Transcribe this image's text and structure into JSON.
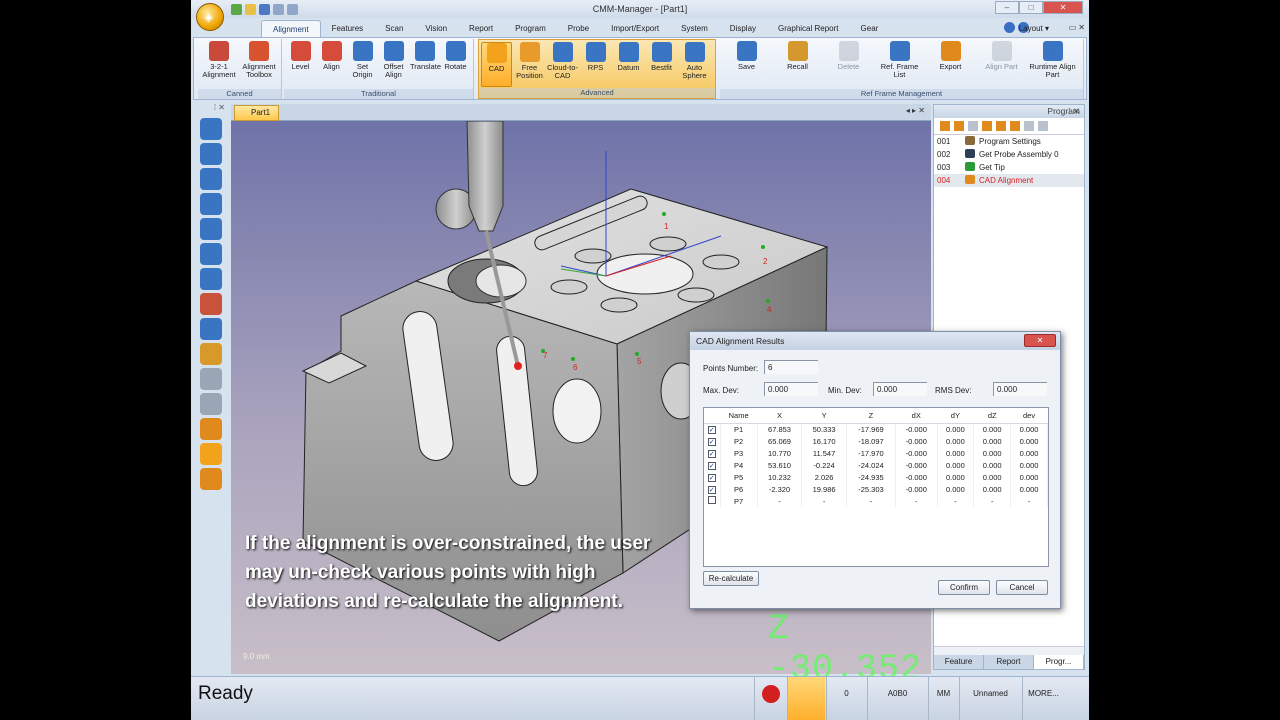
{
  "window": {
    "title": "CMM-Manager - [Part1]",
    "layout_label": "Layout"
  },
  "tabs": [
    "Alignment",
    "Features",
    "Scan",
    "Vision",
    "Report",
    "Program",
    "Probe",
    "Import/Export",
    "System",
    "Display",
    "Graphical Report",
    "Gear"
  ],
  "ribbon": {
    "groups": [
      {
        "name": "Canned",
        "buttons": [
          {
            "label": "3-2-1 Alignment",
            "icon": "three-two-one-icon"
          },
          {
            "label": "Alignment Toolbox",
            "icon": "toolbox-icon"
          }
        ]
      },
      {
        "name": "Traditional",
        "buttons": [
          {
            "label": "Level",
            "icon": "level-icon"
          },
          {
            "label": "Align",
            "icon": "align-icon"
          },
          {
            "label": "Set Origin",
            "icon": "origin-icon"
          },
          {
            "label": "Offset Align",
            "icon": "offset-icon"
          },
          {
            "label": "Translate",
            "icon": "translate-icon"
          },
          {
            "label": "Rotate",
            "icon": "rotate-icon"
          }
        ]
      },
      {
        "name": "Advanced",
        "buttons": [
          {
            "label": "CAD",
            "icon": "cad-icon"
          },
          {
            "label": "Free Position",
            "icon": "free-position-icon"
          },
          {
            "label": "Cloud-to-CAD",
            "icon": "cloud-icon"
          },
          {
            "label": "RPS",
            "icon": "rps-icon"
          },
          {
            "label": "Datum",
            "icon": "datum-icon"
          },
          {
            "label": "Bestfit",
            "icon": "bestfit-icon"
          },
          {
            "label": "Auto Sphere",
            "icon": "sphere-icon"
          }
        ]
      },
      {
        "name": "Ref Frame Management",
        "buttons": [
          {
            "label": "Save",
            "icon": "save-icon"
          },
          {
            "label": "Recall",
            "icon": "recall-icon"
          },
          {
            "label": "Delete",
            "icon": "delete-icon"
          },
          {
            "label": "Ref. Frame List",
            "icon": "list-icon"
          },
          {
            "label": "Export",
            "icon": "export-icon"
          },
          {
            "label": "Align Part",
            "icon": "align-part-icon"
          },
          {
            "label": "Runtime Align Part",
            "icon": "runtime-icon"
          }
        ]
      }
    ]
  },
  "document": {
    "tab": "Part1",
    "scale": "9.0 mm",
    "readout": "Z -30.352"
  },
  "overlay_text": "If the alignment is over-constrained, the user may un-check various points with high deviations and re-calculate the alignment.",
  "program": {
    "title": "Program",
    "items": [
      {
        "num": "001",
        "label": "Program Settings"
      },
      {
        "num": "002",
        "label": "Get Probe Assembly 0"
      },
      {
        "num": "003",
        "label": "Get Tip"
      },
      {
        "num": "004",
        "label": "CAD Alignment"
      }
    ],
    "tabs": [
      "Feature",
      "Report",
      "Progr..."
    ]
  },
  "status": {
    "ready": "Ready",
    "counter": "0",
    "code": "A0B0",
    "units": "MM",
    "name": "Unnamed",
    "more": "MORE..."
  },
  "dialog": {
    "title": "CAD Alignment Results",
    "points_label": "Points Number:",
    "points_value": "6",
    "max_dev_label": "Max. Dev:",
    "max_dev": "0.000",
    "min_dev_label": "Min. Dev:",
    "min_dev": "0.000",
    "rms_dev_label": "RMS Dev:",
    "rms_dev": "0.000",
    "columns": [
      "Name",
      "X",
      "Y",
      "Z",
      "dX",
      "dY",
      "dZ",
      "dev"
    ],
    "rows": [
      {
        "checked": true,
        "cells": [
          "P1",
          "67.853",
          "50.333",
          "-17.969",
          "-0.000",
          "0.000",
          "0.000",
          "0.000"
        ]
      },
      {
        "checked": true,
        "cells": [
          "P2",
          "65.069",
          "16.170",
          "-18.097",
          "-0.000",
          "0.000",
          "0.000",
          "0.000"
        ]
      },
      {
        "checked": true,
        "cells": [
          "P3",
          "10.770",
          "11.547",
          "-17.970",
          "-0.000",
          "0.000",
          "0.000",
          "0.000"
        ]
      },
      {
        "checked": true,
        "cells": [
          "P4",
          "53.610",
          "-0.224",
          "-24.024",
          "-0.000",
          "0.000",
          "0.000",
          "0.000"
        ]
      },
      {
        "checked": true,
        "cells": [
          "P5",
          "10.232",
          "2.026",
          "-24.935",
          "-0.000",
          "0.000",
          "0.000",
          "0.000"
        ]
      },
      {
        "checked": true,
        "cells": [
          "P6",
          "-2.320",
          "19.986",
          "-25.303",
          "-0.000",
          "0.000",
          "0.000",
          "0.000"
        ]
      },
      {
        "checked": false,
        "cells": [
          "P7",
          "-",
          "-",
          "-",
          "-",
          "-",
          "-",
          "-"
        ]
      }
    ],
    "recalc_label": "Re-calculate",
    "confirm_label": "Confirm",
    "cancel_label": "Cancel"
  },
  "colors": {
    "accent": "#f5c65a",
    "ribbon": "#dfe8f3",
    "viewport_top": "#6f73a8",
    "readout": "#55ff55"
  }
}
